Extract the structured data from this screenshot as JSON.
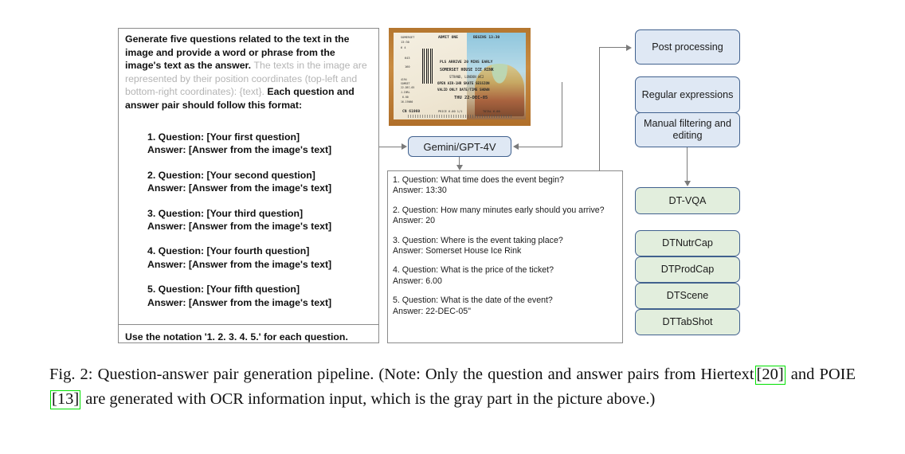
{
  "figure": {
    "caption_label": "Fig. 2:",
    "caption_part1": "Question-answer pair generation pipeline. (Note: Only the question and answer pairs from Hiertext",
    "caption_ref1": "[20]",
    "caption_part2": "and POIE",
    "caption_ref2": "[13]",
    "caption_part3": "are generated with OCR information input, which is the gray part in the picture above.)",
    "ref_highlight_color": "#00e000"
  },
  "prompt_box": {
    "intro_black_1": "Generate five questions related to the text in the image and provide a word or phrase from the image's text as the answer.",
    "intro_gray": "The texts in the image are represented by their position coordinates (top-left and bottom-right coordinates): {text}.",
    "intro_black_2": "Each question and answer pair should follow this format:",
    "gray_color": "#b4b4b4",
    "template_pairs": [
      {
        "question": "1. Question: [Your first question]",
        "answer": "Answer: [Answer from the image's text]"
      },
      {
        "question": "2. Question: [Your second question]",
        "answer": "Answer: [Answer from the image's text]"
      },
      {
        "question": "3. Question: [Your third question]",
        "answer": "Answer: [Answer from the image's text]"
      },
      {
        "question": "4. Question: [Your fourth question]",
        "answer": "Answer: [Answer from the image's text]"
      },
      {
        "question": "5. Question: [Your fifth question]",
        "answer": "Answer: [Answer from the image's text]"
      }
    ],
    "footer": "Use the notation '1. 2. 3. 4. 5.' for each question."
  },
  "ticket": {
    "alt": "photo of a printed admission ticket",
    "lines": [
      "ADMIT ONE",
      "BEGINS 13:30",
      "PLS ARRIVE 20 MINS EARLY",
      "SOMERSET HOUSE ICE RINK",
      "STRAND, LONDON WC2",
      "OPEN AIR-1HR SKATE SESSION",
      "VALID ONLY DATE/TIME SHOWN",
      "THU 22-DEC-05",
      "PRICE   6.00 1/1",
      "TOTAL   6.00",
      "CN 61960"
    ],
    "stub": [
      "SOMERSET",
      "13:30",
      "6 4",
      "643",
      "160",
      "4194",
      "SOMSET",
      "22-DEC-05",
      "J-IHRL",
      "6.00",
      "16-19060"
    ]
  },
  "model": {
    "label": "Gemini/GPT-4V"
  },
  "output_box": {
    "pairs": [
      {
        "question": "1. Question: What time does the event begin?",
        "answer": "Answer: 13:30"
      },
      {
        "question": "2. Question: How many minutes early should you arrive?",
        "answer": "Answer: 20"
      },
      {
        "question": "3. Question: Where is the event taking place?",
        "answer": "Answer: Somerset House Ice Rink"
      },
      {
        "question": "4. Question: What is the price of the ticket?",
        "answer": "Answer: 6.00"
      },
      {
        "question": "5. Question: What is the date of the event?",
        "answer": "Answer: 22-DEC-05\""
      }
    ]
  },
  "pipeline": {
    "blue_color": "#dfe8f4",
    "green_color": "#e2eedd",
    "border_color": "#41618e",
    "post_processing": {
      "label": "Post processing"
    },
    "steps": [
      {
        "label": "Regular expressions"
      },
      {
        "label": "Manual filtering and editing"
      }
    ],
    "datasets_primary": {
      "label": "DT-VQA"
    },
    "datasets": [
      {
        "label": "DTNutrCap"
      },
      {
        "label": "DTProdCap"
      },
      {
        "label": "DTScene"
      },
      {
        "label": "DTTabShot"
      }
    ]
  }
}
